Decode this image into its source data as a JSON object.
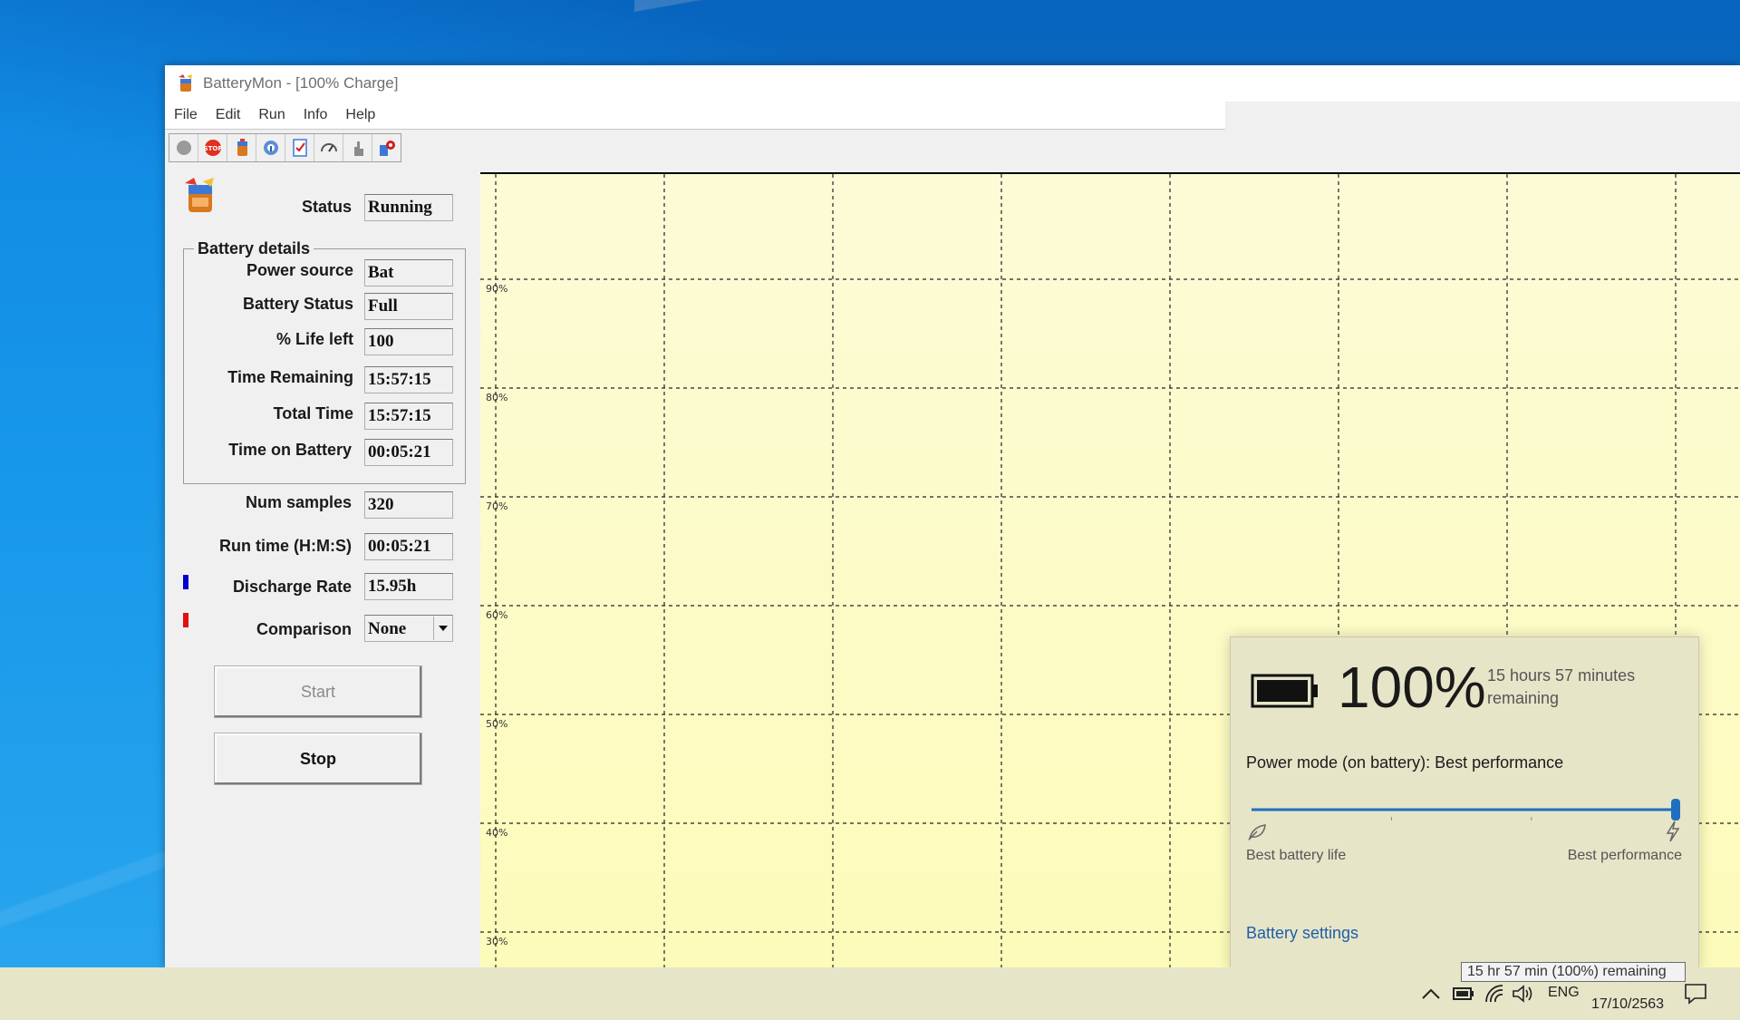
{
  "window": {
    "title": "BatteryMon - [100% Charge]"
  },
  "menu": [
    "File",
    "Edit",
    "Run",
    "Info",
    "Help"
  ],
  "toolbar": {
    "icons": [
      "record-icon",
      "stop-icon",
      "battery-icon",
      "info-icon",
      "checklist-icon",
      "gauge-icon",
      "hand-icon",
      "settings-icon"
    ]
  },
  "status": {
    "label": "Status",
    "value": "Running"
  },
  "battery_details": {
    "title": "Battery details",
    "rows": [
      {
        "label": "Power source",
        "value": "Bat"
      },
      {
        "label": "Battery Status",
        "value": "Full"
      },
      {
        "label": "% Life left",
        "value": "100"
      },
      {
        "label": "Time Remaining",
        "value": "15:57:15"
      },
      {
        "label": "Total Time",
        "value": "15:57:15"
      },
      {
        "label": "Time on Battery",
        "value": "00:05:21"
      }
    ]
  },
  "stats": {
    "num_samples_label": "Num samples",
    "num_samples": "320",
    "run_time_label": "Run time (H:M:S)",
    "run_time": "00:05:21",
    "discharge_label": "Discharge Rate",
    "discharge": "15.95h",
    "comparison_label": "Comparison",
    "comparison_value": "None"
  },
  "buttons": {
    "start": "Start",
    "stop": "Stop"
  },
  "colors": {
    "discharge_marker": "#0000cc",
    "comparison_marker": "#e01010"
  },
  "chart_data": {
    "type": "line",
    "y_tick_labels": [
      "90%",
      "80%",
      "70%",
      "60%",
      "50%",
      "40%",
      "30%"
    ],
    "series": []
  },
  "flyout": {
    "percent": "100%",
    "remaining": "15 hours 57 minutes remaining",
    "power_mode": "Power mode (on battery): Best performance",
    "slider_level": 1.0,
    "min_label": "Best battery life",
    "max_label": "Best performance",
    "settings_link": "Battery settings"
  },
  "taskbar": {
    "tooltip": "15 hr 57 min (100%) remaining",
    "language": "ENG",
    "date": "17/10/2563"
  }
}
